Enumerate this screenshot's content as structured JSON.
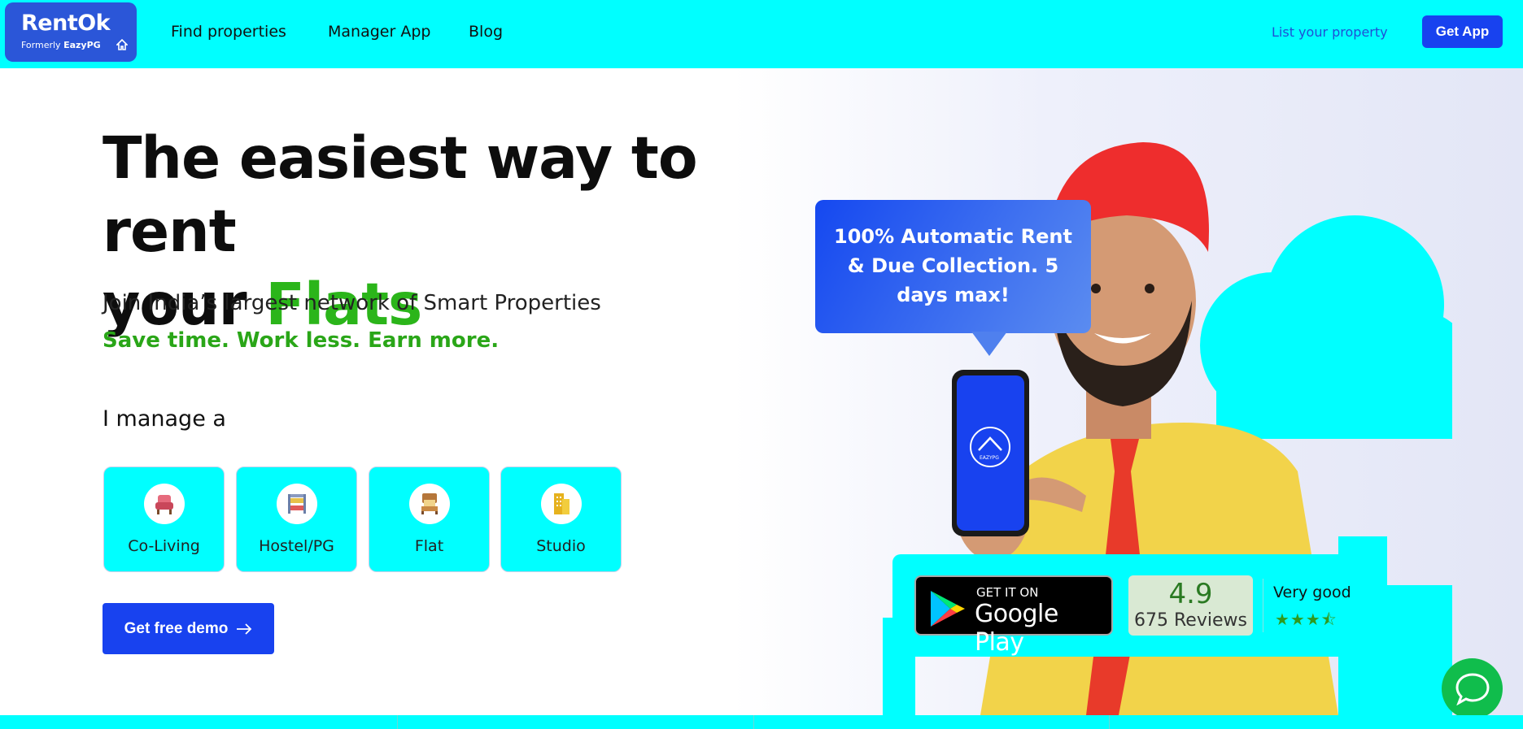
{
  "header": {
    "logo_brand": "RentOk",
    "logo_formerly": "Formerly",
    "logo_formerly_brand": "EazyPG",
    "nav": [
      "Find properties",
      "Manager App",
      "Blog"
    ],
    "list_property": "List your property",
    "get_app": "Get App"
  },
  "hero": {
    "title_line1": "The easiest way to rent",
    "title_prefix": "your",
    "title_accent": "Flats",
    "subtitle": "Join India’s largest network of Smart Properties",
    "tagline": "Save time. Work less. Earn more.",
    "manage_label": "I manage a",
    "categories": [
      "Co-Living",
      "Hostel/PG",
      "Flat",
      "Studio"
    ],
    "demo_button": "Get free demo"
  },
  "bubble": {
    "text": "100% Automatic Rent & Due Collection. 5 days max!"
  },
  "phone": {
    "app_label": "EAZYPG"
  },
  "rating": {
    "store_small": "GET IT ON",
    "store_big": "Google Play",
    "score": "4.9",
    "reviews": "675 Reviews",
    "quality": "Very good",
    "stars": "★★★⯪"
  },
  "colors": {
    "brand_blue": "#1842ef",
    "accent_green": "#2bb51a",
    "cyan": "#00ffff",
    "chat_green": "#10bd4c"
  }
}
